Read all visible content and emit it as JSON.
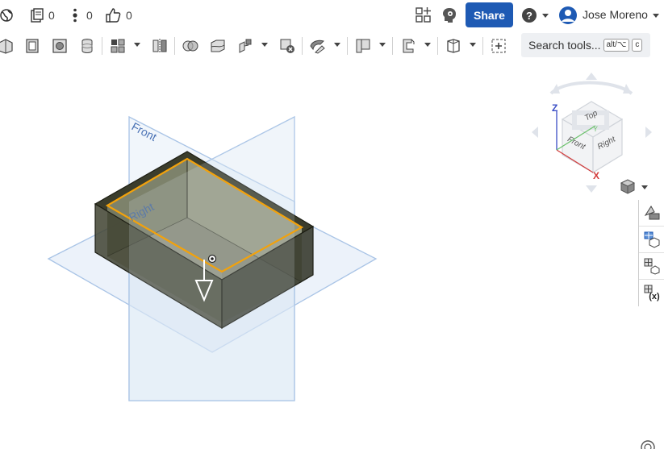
{
  "header": {
    "documents_count": "0",
    "branches_count": "0",
    "likes_count": "0",
    "share_label": "Share",
    "user_name": "Jose Moreno"
  },
  "toolbar": {
    "search_label": "Search tools...",
    "shortcut_key1": "alt/⌥",
    "shortcut_key2": "c"
  },
  "viewport": {
    "plane_front_label": "Front",
    "plane_right_label": "Right"
  },
  "view_cube": {
    "face_top": "Top",
    "face_front": "Front",
    "face_right": "Right",
    "axis_z": "Z",
    "axis_x": "X",
    "axis_y": "Y"
  },
  "colors": {
    "accent": "#1e5ab4",
    "selection": "#f2a20c",
    "plane": "#a9c4e6"
  }
}
